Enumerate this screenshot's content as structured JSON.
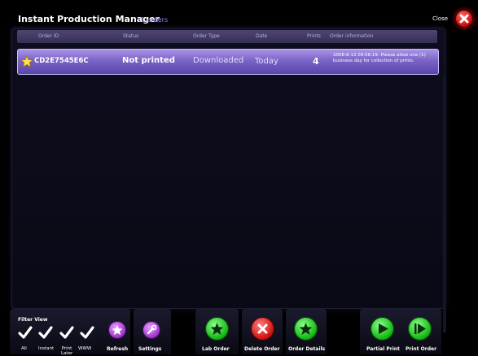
{
  "app": {
    "title": "Instant Production Manager",
    "order_count": "1 orders",
    "close_label": "Close"
  },
  "table": {
    "columns": [
      "Order ID",
      "Status",
      "Order Type",
      "Date",
      "Prints",
      "Order information"
    ],
    "rows": [
      {
        "order_id": "CD2E7545E6C",
        "status": "Not printed",
        "order_type": "Downloaded",
        "date": "Today",
        "prints": "4",
        "info": "2008-8-13 09:56:19. Please allow one (1) business day for collection of prints.",
        "icon": "star-icon"
      }
    ]
  },
  "filter": {
    "title": "Filter View",
    "options": [
      "All",
      "Instant",
      "Print Later",
      "WWW"
    ]
  },
  "toolbar": {
    "refresh": "Refresh",
    "settings": "Settings",
    "lab_order": "Lab Order",
    "delete_order": "Delete Order",
    "order_details": "Order Details",
    "partial_print": "Partial Print",
    "print_order": "Print Order"
  },
  "colors": {
    "accent_purple": "#7b63c7",
    "count_text": "#8f86ff",
    "green": "#1bbd1b",
    "red": "#d41818"
  }
}
